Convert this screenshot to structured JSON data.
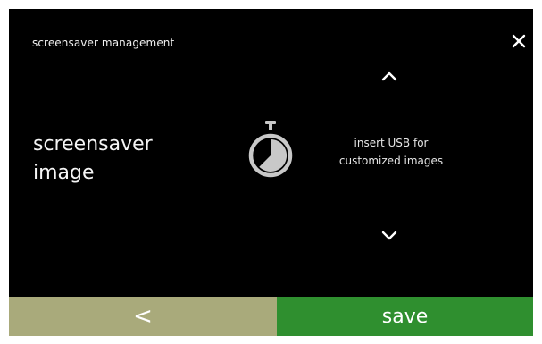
{
  "header": {
    "title": "screensaver management",
    "close_icon": "close-icon"
  },
  "setting": {
    "label_line1": "screensaver",
    "label_line2": "image",
    "icon": "stopwatch-icon",
    "info_line1": "insert USB for",
    "info_line2": "customized images"
  },
  "nav": {
    "up_icon": "chevron-up-icon",
    "down_icon": "chevron-down-icon"
  },
  "footer": {
    "back_label": "<",
    "save_label": "save"
  },
  "colors": {
    "background": "#000000",
    "back_button": "#a9aa7b",
    "save_button": "#2f8f2f",
    "icon": "#c8c8c8"
  }
}
